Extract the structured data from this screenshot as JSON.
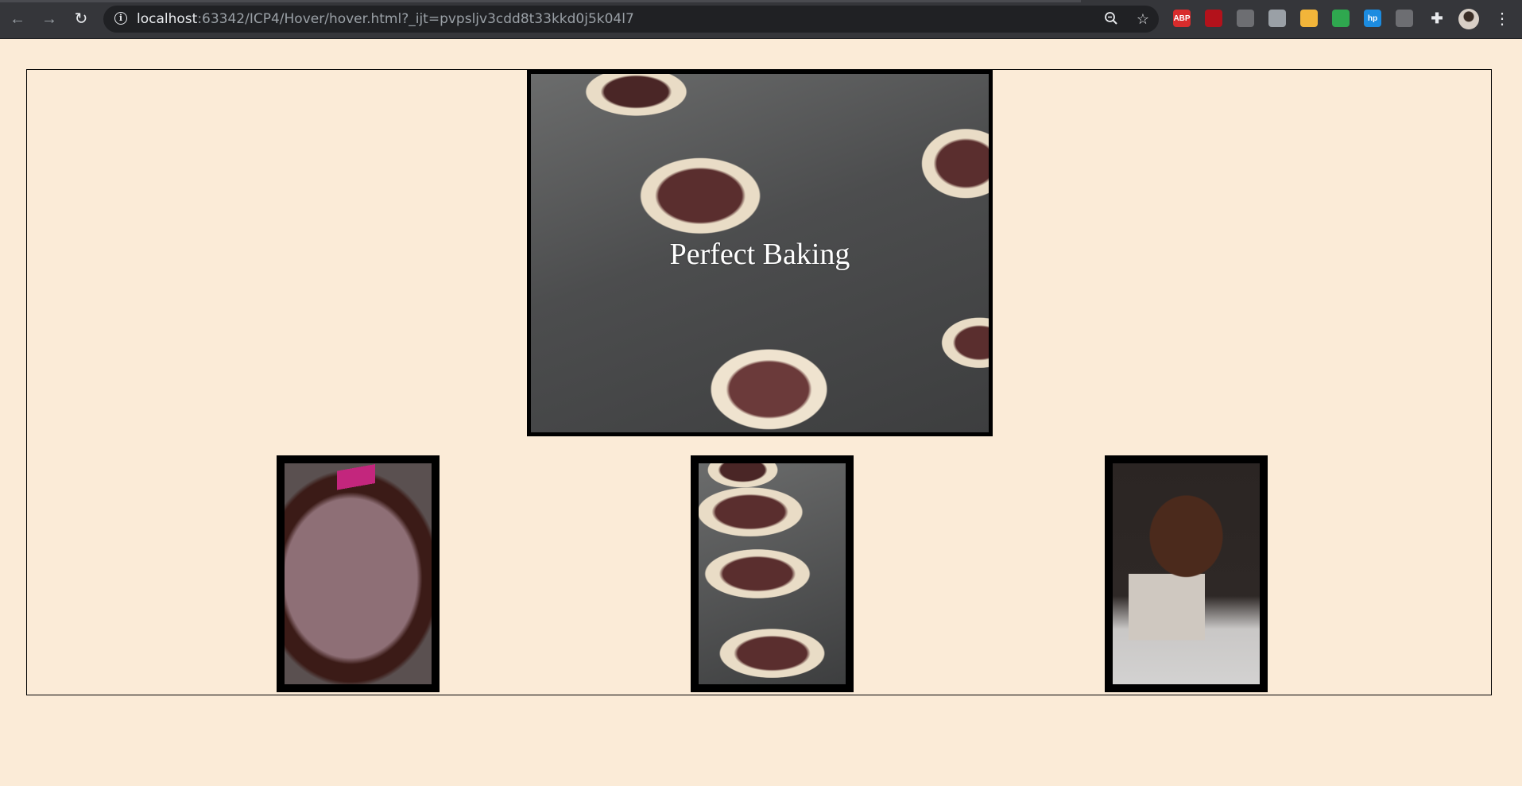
{
  "browser": {
    "url_host": "localhost",
    "url_rest": ":63342/ICP4/Hover/hover.html?_ijt=pvpsljv3cdd8t33kkd0j5k04l7",
    "nav": {
      "back": "←",
      "forward": "→",
      "reload": "↻"
    },
    "extensions": [
      {
        "name": "adblock-plus-icon",
        "label": "ABP",
        "color": "#d82c2c"
      },
      {
        "name": "acrobat-icon",
        "label": "",
        "color": "#b3121b"
      },
      {
        "name": "printer-ext-icon",
        "label": "",
        "color": "#6d6e72"
      },
      {
        "name": "grid-ext-icon",
        "label": "",
        "color": "#9aa0a6"
      },
      {
        "name": "hand-ext-icon",
        "label": "",
        "color": "#f2b53a"
      },
      {
        "name": "color-ext-icon",
        "label": "",
        "color": "#2fa84f"
      },
      {
        "name": "hp-icon",
        "label": "hp",
        "color": "#1c8ce0"
      },
      {
        "name": "shield-ext-icon",
        "label": "",
        "color": "#6d6e72"
      }
    ]
  },
  "page": {
    "hero_title": "Perfect Baking",
    "background": "#fbebd7"
  }
}
